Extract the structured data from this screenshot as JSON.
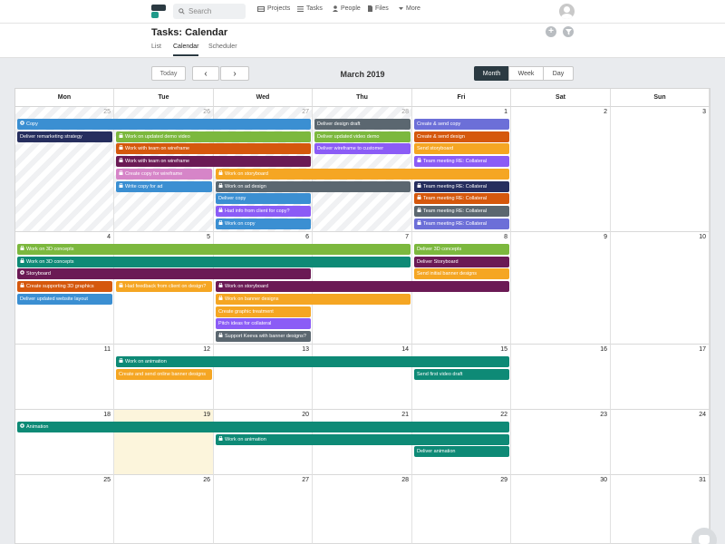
{
  "topbar": {
    "search_placeholder": "Search",
    "nav": [
      {
        "label": "Projects",
        "icon": "inbox-icon"
      },
      {
        "label": "Tasks",
        "icon": "list-icon"
      },
      {
        "label": "People",
        "icon": "person-icon"
      },
      {
        "label": "Files",
        "icon": "file-icon"
      },
      {
        "label": "More",
        "icon": "caret-down-icon"
      }
    ]
  },
  "header": {
    "title": "Tasks: Calendar",
    "tabs": [
      "List",
      "Calendar",
      "Scheduler"
    ],
    "active_tab": "Calendar"
  },
  "toolbar": {
    "today": "Today",
    "prev": "‹",
    "next": "›",
    "month_title": "March 2019",
    "views": [
      "Month",
      "Week",
      "Day"
    ],
    "active_view": "Month"
  },
  "calendar": {
    "weekdays": [
      "Mon",
      "Tue",
      "Wed",
      "Thu",
      "Fri",
      "Sat",
      "Sun"
    ],
    "weeks": [
      [
        "25",
        "26",
        "27",
        "28",
        "1",
        "2",
        "3"
      ],
      [
        "4",
        "5",
        "6",
        "7",
        "8",
        "9",
        "10"
      ],
      [
        "11",
        "12",
        "13",
        "14",
        "15",
        "16",
        "17"
      ],
      [
        "18",
        "19",
        "20",
        "21",
        "22",
        "23",
        "24"
      ],
      [
        "25",
        "26",
        "27",
        "28",
        "29",
        "30",
        "31"
      ]
    ],
    "events": [
      {
        "week": 0,
        "start": 0,
        "span": 3,
        "lane": 0,
        "title": "Copy",
        "color": "#3b8fd2",
        "icon": "circle"
      },
      {
        "week": 0,
        "start": 3,
        "span": 1,
        "lane": 0,
        "title": "Deliver design draft",
        "color": "#5b6770",
        "icon": ""
      },
      {
        "week": 0,
        "start": 4,
        "span": 1,
        "lane": 0,
        "title": "Create & send copy",
        "color": "#6c6fd8",
        "icon": ""
      },
      {
        "week": 0,
        "start": 0,
        "span": 1,
        "lane": 1,
        "title": "Deliver remarketing strategy",
        "color": "#262e5e",
        "icon": ""
      },
      {
        "week": 0,
        "start": 1,
        "span": 2,
        "lane": 1,
        "title": "Work on updated demo video",
        "color": "#7cb83e",
        "icon": "lock"
      },
      {
        "week": 0,
        "start": 3,
        "span": 1,
        "lane": 1,
        "title": "Deliver updated video demo",
        "color": "#7cb83e",
        "icon": ""
      },
      {
        "week": 0,
        "start": 4,
        "span": 1,
        "lane": 1,
        "title": "Create & send design",
        "color": "#d5580d",
        "icon": ""
      },
      {
        "week": 0,
        "start": 1,
        "span": 2,
        "lane": 2,
        "title": "Work with team on wireframe",
        "color": "#d5580d",
        "icon": "lock"
      },
      {
        "week": 0,
        "start": 3,
        "span": 1,
        "lane": 2,
        "title": "Deliver wireframe to customer",
        "color": "#8b5cf6",
        "icon": ""
      },
      {
        "week": 0,
        "start": 4,
        "span": 1,
        "lane": 2,
        "title": "Send storyboard",
        "color": "#f5a623",
        "icon": ""
      },
      {
        "week": 0,
        "start": 1,
        "span": 2,
        "lane": 3,
        "title": "Work with team on wireframe",
        "color": "#6b1a55",
        "icon": "lock"
      },
      {
        "week": 0,
        "start": 4,
        "span": 1,
        "lane": 3,
        "title": "Team meeting RE: Collateral",
        "color": "#8b5cf6",
        "icon": "lock"
      },
      {
        "week": 0,
        "start": 1,
        "span": 1,
        "lane": 4,
        "title": "Create copy for wireframe",
        "color": "#d685c8",
        "icon": "lock"
      },
      {
        "week": 0,
        "start": 2,
        "span": 3,
        "lane": 4,
        "title": "Work on storyboard",
        "color": "#f5a623",
        "icon": "lock"
      },
      {
        "week": 0,
        "start": 1,
        "span": 1,
        "lane": 5,
        "title": "Write copy for ad",
        "color": "#3b8fd2",
        "icon": "lock"
      },
      {
        "week": 0,
        "start": 2,
        "span": 2,
        "lane": 5,
        "title": "Work on ad design",
        "color": "#5b6770",
        "icon": "lock"
      },
      {
        "week": 0,
        "start": 4,
        "span": 1,
        "lane": 5,
        "title": "Team meeting RE: Collateral",
        "color": "#262e5e",
        "icon": "lock"
      },
      {
        "week": 0,
        "start": 2,
        "span": 1,
        "lane": 6,
        "title": "Deliver copy",
        "color": "#3b8fd2",
        "icon": ""
      },
      {
        "week": 0,
        "start": 4,
        "span": 1,
        "lane": 6,
        "title": "Team meeting RE: Collateral",
        "color": "#d5580d",
        "icon": "lock"
      },
      {
        "week": 0,
        "start": 2,
        "span": 1,
        "lane": 7,
        "title": "Had info from client for copy?",
        "color": "#8b5cf6",
        "icon": "lock"
      },
      {
        "week": 0,
        "start": 4,
        "span": 1,
        "lane": 7,
        "title": "Team meeting RE: Collateral",
        "color": "#5b6770",
        "icon": "lock"
      },
      {
        "week": 0,
        "start": 2,
        "span": 1,
        "lane": 8,
        "title": "Work on copy",
        "color": "#3b8fd2",
        "icon": "lock"
      },
      {
        "week": 0,
        "start": 4,
        "span": 1,
        "lane": 8,
        "title": "Team meeting RE: Collateral",
        "color": "#6c6fd8",
        "icon": "lock"
      },
      {
        "week": 1,
        "start": 0,
        "span": 4,
        "lane": 0,
        "title": "Work on 3D concepts",
        "color": "#7cb83e",
        "icon": "lock"
      },
      {
        "week": 1,
        "start": 4,
        "span": 1,
        "lane": 0,
        "title": "Deliver 3D concepts",
        "color": "#7cb83e",
        "icon": ""
      },
      {
        "week": 1,
        "start": 0,
        "span": 4,
        "lane": 1,
        "title": "Work on 3D concepts",
        "color": "#0e8a76",
        "icon": "lock"
      },
      {
        "week": 1,
        "start": 4,
        "span": 1,
        "lane": 1,
        "title": "Deliver Storyboard",
        "color": "#6b1a55",
        "icon": ""
      },
      {
        "week": 1,
        "start": 0,
        "span": 3,
        "lane": 2,
        "title": "Storyboard",
        "color": "#6b1a55",
        "icon": "circle"
      },
      {
        "week": 1,
        "start": 4,
        "span": 1,
        "lane": 2,
        "title": "Send initial banner designs",
        "color": "#f5a623",
        "icon": ""
      },
      {
        "week": 1,
        "start": 0,
        "span": 1,
        "lane": 3,
        "title": "Create supporting 3D graphics",
        "color": "#d5580d",
        "icon": "lock"
      },
      {
        "week": 1,
        "start": 1,
        "span": 1,
        "lane": 3,
        "title": "Had feedback from client on design?",
        "color": "#f5a623",
        "icon": "lock"
      },
      {
        "week": 1,
        "start": 2,
        "span": 3,
        "lane": 3,
        "title": "Work on storyboard",
        "color": "#6b1a55",
        "icon": "lock"
      },
      {
        "week": 1,
        "start": 0,
        "span": 1,
        "lane": 4,
        "title": "Deliver updated website layout",
        "color": "#3b8fd2",
        "icon": ""
      },
      {
        "week": 1,
        "start": 2,
        "span": 2,
        "lane": 4,
        "title": "Work on banner designs",
        "color": "#f5a623",
        "icon": "lock"
      },
      {
        "week": 1,
        "start": 2,
        "span": 1,
        "lane": 5,
        "title": "Create graphic treatment",
        "color": "#f5a623",
        "icon": ""
      },
      {
        "week": 1,
        "start": 2,
        "span": 1,
        "lane": 6,
        "title": "Pitch ideas for collateral",
        "color": "#8b5cf6",
        "icon": ""
      },
      {
        "week": 1,
        "start": 2,
        "span": 1,
        "lane": 7,
        "title": "Support Keeva with banner designs?",
        "color": "#5b6770",
        "icon": "lock"
      },
      {
        "week": 2,
        "start": 1,
        "span": 4,
        "lane": 0,
        "title": "Work on animation",
        "color": "#0e8a76",
        "icon": "lock"
      },
      {
        "week": 2,
        "start": 1,
        "span": 1,
        "lane": 1,
        "title": "Create and send online banner designs",
        "color": "#f5a623",
        "icon": ""
      },
      {
        "week": 2,
        "start": 4,
        "span": 1,
        "lane": 1,
        "title": "Send first video draft",
        "color": "#0e8a76",
        "icon": ""
      },
      {
        "week": 3,
        "start": 0,
        "span": 5,
        "lane": 0,
        "title": "Animation",
        "color": "#0e8a76",
        "icon": "circle"
      },
      {
        "week": 3,
        "start": 2,
        "span": 3,
        "lane": 1,
        "title": "Work on animation",
        "color": "#0e8a76",
        "icon": "lock"
      },
      {
        "week": 3,
        "start": 4,
        "span": 1,
        "lane": 2,
        "title": "Deliver animation",
        "color": "#0e8a76",
        "icon": ""
      }
    ]
  }
}
